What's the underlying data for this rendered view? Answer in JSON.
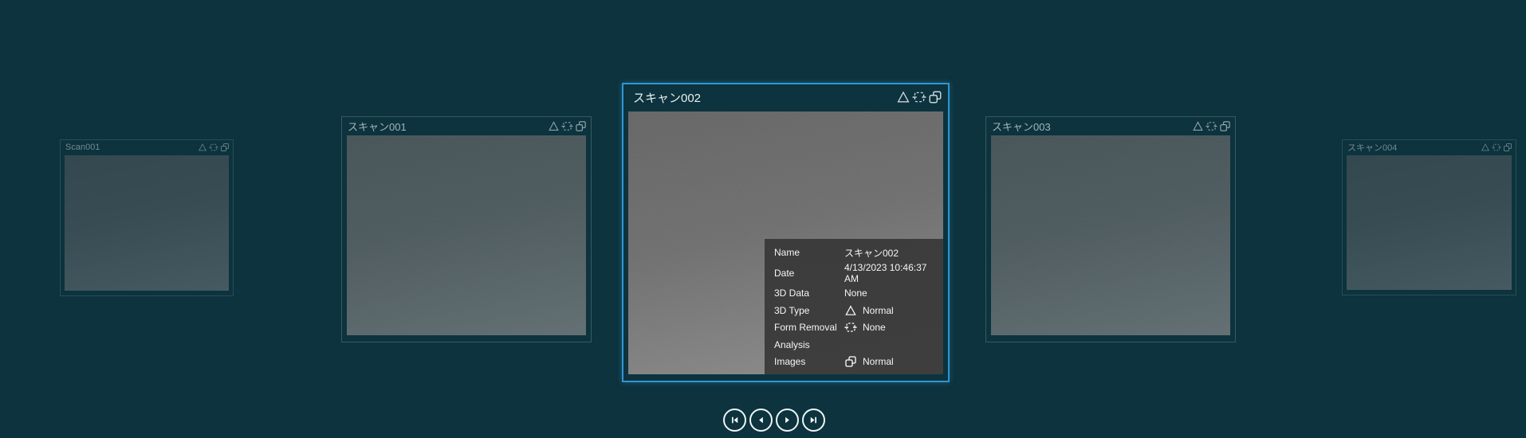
{
  "page": {
    "background_color": "#0c333e",
    "accent_color": "#3095d2",
    "tooltip_background": "#383838"
  },
  "carousel": {
    "cards": [
      {
        "title": "Scan001",
        "selected": false,
        "distance": "far"
      },
      {
        "title": "スキャン001",
        "selected": false,
        "distance": "near"
      },
      {
        "title": "スキャン002",
        "selected": true,
        "distance": "current"
      },
      {
        "title": "スキャン003",
        "selected": false,
        "distance": "near"
      },
      {
        "title": "スキャン004",
        "selected": false,
        "distance": "far"
      }
    ],
    "badge_icons": [
      "3d-type-triangle-icon",
      "form-removal-icon",
      "images-icon"
    ]
  },
  "tooltip": {
    "rows": [
      {
        "label": "Name",
        "value": "スキャン002"
      },
      {
        "label": "Date",
        "value": "4/13/2023 10:46:37 AM"
      },
      {
        "label": "3D Data",
        "value": "None"
      },
      {
        "label": "3D Type",
        "value": "Normal",
        "icon": "triangle-icon"
      },
      {
        "label": "Form Removal",
        "value": "None",
        "icon": "form-removal-icon"
      },
      {
        "label": "Analysis",
        "value": ""
      },
      {
        "label": "Images",
        "value": "Normal",
        "icon": "images-icon"
      }
    ]
  },
  "navigation": {
    "buttons": [
      {
        "icon": "skip-to-first-icon"
      },
      {
        "icon": "previous-icon"
      },
      {
        "icon": "next-icon"
      },
      {
        "icon": "skip-to-last-icon"
      }
    ]
  }
}
